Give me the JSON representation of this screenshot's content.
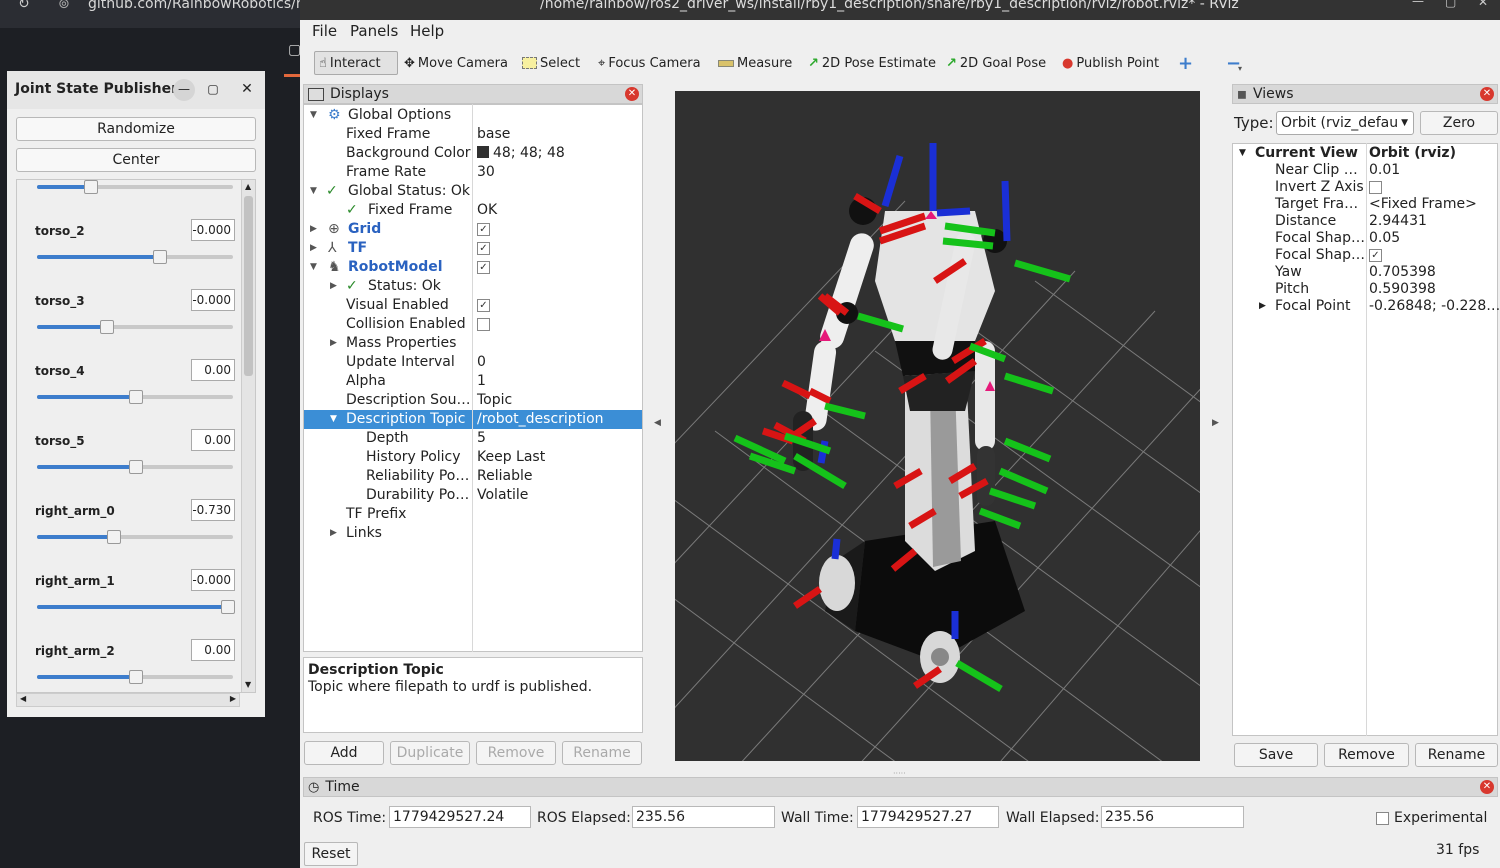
{
  "browser": {
    "url": "github.com/RainbowRobotics/rby"
  },
  "window": {
    "title": "/home/rainbow/ros2_driver_ws/install/rby1_description/share/rby1_description/rviz/robot.rviz* - RViz"
  },
  "menu": {
    "items": [
      "File",
      "Panels",
      "Help"
    ]
  },
  "toolbar": {
    "interact": "Interact",
    "move_camera": "Move Camera",
    "select": "Select",
    "focus_camera": "Focus Camera",
    "measure": "Measure",
    "pose_estimate": "2D Pose Estimate",
    "goal_pose": "2D Goal Pose",
    "publish_point": "Publish Point",
    "plus": "+",
    "minus": "−"
  },
  "displays": {
    "title": "Displays",
    "rows": [
      {
        "label": "Global Options",
        "value": ""
      },
      {
        "label": "Fixed Frame",
        "value": "base"
      },
      {
        "label": "Background Color",
        "value": "48; 48; 48"
      },
      {
        "label": "Frame Rate",
        "value": "30"
      },
      {
        "label": "Global Status: Ok",
        "value": ""
      },
      {
        "label": "Fixed Frame",
        "value": "OK"
      },
      {
        "label": "Grid",
        "value": ""
      },
      {
        "label": "TF",
        "value": ""
      },
      {
        "label": "RobotModel",
        "value": ""
      },
      {
        "label": "Status: Ok",
        "value": ""
      },
      {
        "label": "Visual Enabled",
        "value": ""
      },
      {
        "label": "Collision Enabled",
        "value": ""
      },
      {
        "label": "Mass Properties",
        "value": ""
      },
      {
        "label": "Update Interval",
        "value": "0"
      },
      {
        "label": "Alpha",
        "value": "1"
      },
      {
        "label": "Description Sou…",
        "value": "Topic"
      },
      {
        "label": "Description Topic",
        "value": "/robot_description"
      },
      {
        "label": "Depth",
        "value": "5"
      },
      {
        "label": "History Policy",
        "value": "Keep Last"
      },
      {
        "label": "Reliability Po…",
        "value": "Reliable"
      },
      {
        "label": "Durability Po…",
        "value": "Volatile"
      },
      {
        "label": "TF Prefix",
        "value": ""
      },
      {
        "label": "Links",
        "value": ""
      }
    ],
    "background_color": "#303030",
    "description_title": "Description Topic",
    "description_text": "Topic where filepath to urdf is published.",
    "buttons": {
      "add": "Add",
      "duplicate": "Duplicate",
      "remove": "Remove",
      "rename": "Rename"
    }
  },
  "views": {
    "title": "Views",
    "type_label": "Type:",
    "type_value": "Orbit (rviz_defau",
    "zero": "Zero",
    "header_label": "Current View",
    "header_value": "Orbit (rviz)",
    "rows": [
      {
        "label": "Near Clip …",
        "value": "0.01"
      },
      {
        "label": "Invert Z Axis",
        "value": ""
      },
      {
        "label": "Target Fra…",
        "value": "<Fixed Frame>"
      },
      {
        "label": "Distance",
        "value": "2.94431"
      },
      {
        "label": "Focal Shap…",
        "value": "0.05"
      },
      {
        "label": "Focal Shap…",
        "value": ""
      },
      {
        "label": "Yaw",
        "value": "0.705398"
      },
      {
        "label": "Pitch",
        "value": "0.590398"
      },
      {
        "label": "Focal Point",
        "value": "-0.26848; -0.228…"
      }
    ],
    "buttons": {
      "save": "Save",
      "remove": "Remove",
      "rename": "Rename"
    }
  },
  "time": {
    "title": "Time",
    "ros_time_label": "ROS Time:",
    "ros_time": "1779429527.24",
    "ros_elapsed_label": "ROS Elapsed:",
    "ros_elapsed": "235.56",
    "wall_time_label": "Wall Time:",
    "wall_time": "1779429527.27",
    "wall_elapsed_label": "Wall Elapsed:",
    "wall_elapsed": "235.56",
    "experimental": "Experimental",
    "reset": "Reset",
    "fps": "31 fps"
  },
  "jsp": {
    "title": "Joint State Publisher",
    "randomize": "Randomize",
    "center": "Center",
    "joints": [
      {
        "name": "torso_2",
        "value": "-0.000",
        "fraction": 0.62
      },
      {
        "name": "torso_3",
        "value": "-0.000",
        "fraction": 0.35
      },
      {
        "name": "torso_4",
        "value": "0.00",
        "fraction": 0.5
      },
      {
        "name": "torso_5",
        "value": "0.00",
        "fraction": 0.5
      },
      {
        "name": "right_arm_0",
        "value": "-0.730",
        "fraction": 0.39
      },
      {
        "name": "right_arm_1",
        "value": "-0.000",
        "fraction": 0.97
      },
      {
        "name": "right_arm_2",
        "value": "0.00",
        "fraction": 0.5
      }
    ],
    "top_slider_fraction": 0.27
  }
}
